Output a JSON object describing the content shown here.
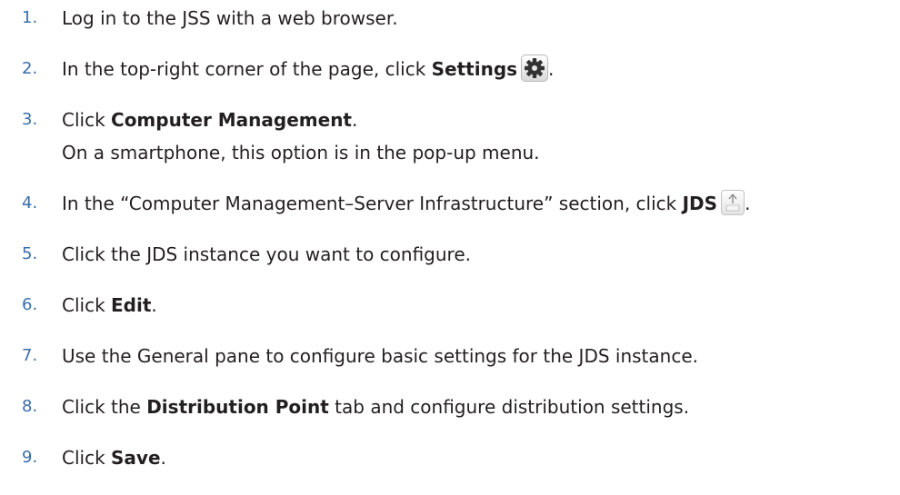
{
  "steps": [
    {
      "number": "1.",
      "text": "Log in to the JSS with a web browser."
    },
    {
      "number": "2.",
      "pre": "In the top-right corner of the page, click ",
      "bold": "Settings",
      "icon": "gear-icon",
      "post": "."
    },
    {
      "number": "3.",
      "pre": "Click ",
      "bold": "Computer Management",
      "post": ".",
      "continuation": "On a smartphone, this option is in the pop-up menu."
    },
    {
      "number": "4.",
      "pre": "In the “Computer Management–Server Infrastructure” section, click ",
      "bold": "JDS",
      "icon": "jds-icon",
      "post": "."
    },
    {
      "number": "5.",
      "text": "Click the JDS instance you want to configure."
    },
    {
      "number": "6.",
      "pre": "Click ",
      "bold": "Edit",
      "post": "."
    },
    {
      "number": "7.",
      "text": "Use the General pane to configure basic settings for the JDS instance."
    },
    {
      "number": "8.",
      "pre": "Click the ",
      "bold": "Distribution Point",
      "post": " tab and configure distribution settings."
    },
    {
      "number": "9.",
      "pre": "Click ",
      "bold": "Save",
      "post": "."
    }
  ],
  "colors": {
    "step_number": "#3b6ea8",
    "text": "#231f20"
  }
}
